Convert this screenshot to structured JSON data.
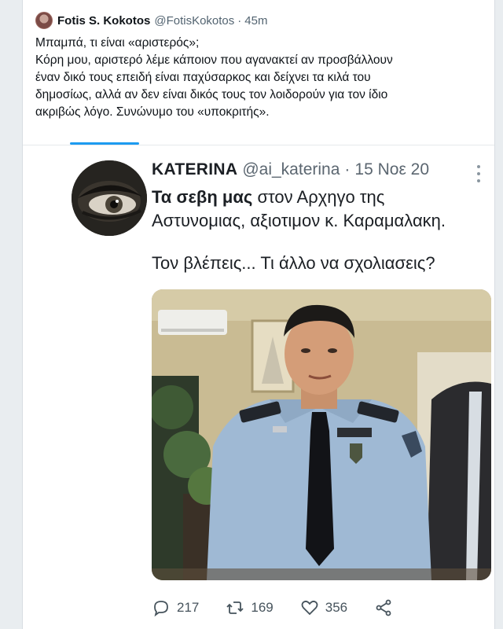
{
  "tweet": {
    "author_name": "Fotis S. Kokotos",
    "author_handle": "@FotisKokotos",
    "separator": "·",
    "time": "45m",
    "lines": [
      "Μπαμπά, τι είναι «αριστερός»;",
      "Κόρη μου, αριστερό λέμε κάποιον που αγανακτεί αν προσβάλλουν",
      "έναν δικό τους επειδή είναι παχύσαρκος και δείχνει τα κιλά του",
      "δημοσίως, αλλά αν δεν είναι δικός τους τον λοιδορούν για τον ίδιο",
      "ακριβώς λόγο. Συνώνυμο του «υποκριτής»."
    ]
  },
  "embedded": {
    "name": "KATERINA",
    "handle": "@ai_katerina",
    "separator": "·",
    "date": "15 Νοε 20",
    "text_bold": "Τα σεβη μας",
    "text_rest": " στον Αρχηγο της",
    "text_line2": "Αστυνομιας, αξιοτιμον κ. Καραμαλακη.",
    "text_paragraph2": "Τον βλέπεις... Τι άλλο να σχολιασεις?"
  },
  "actions": {
    "replies": "217",
    "retweets": "169",
    "likes": "356"
  },
  "icons": [
    "reply-icon",
    "retweet-icon",
    "like-icon",
    "share-icon",
    "more-icon"
  ],
  "colors": {
    "accent": "#1d9bf0",
    "text": "#0f1419",
    "muted": "#536471"
  }
}
